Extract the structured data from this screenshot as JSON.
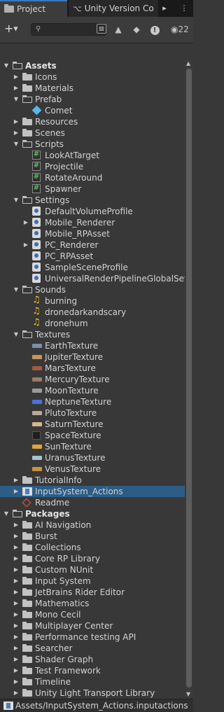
{
  "tabs": [
    {
      "label": "Project",
      "icon": "folder-icon",
      "active": true
    },
    {
      "label": "Unity Version Co",
      "icon": "version-control-icon",
      "active": false
    }
  ],
  "toolbar": {
    "create_label": "+",
    "search_placeholder": "",
    "hidden_count": "22"
  },
  "tree": [
    {
      "label": "Assets",
      "depth": 0,
      "arrow": "open",
      "icon": "folder-open",
      "bold": true
    },
    {
      "label": "Icons",
      "depth": 1,
      "arrow": "closed",
      "icon": "folder"
    },
    {
      "label": "Materials",
      "depth": 1,
      "arrow": "closed",
      "icon": "folder"
    },
    {
      "label": "Prefab",
      "depth": 1,
      "arrow": "open",
      "icon": "folder-open"
    },
    {
      "label": "Comet",
      "depth": 2,
      "arrow": "",
      "icon": "prefab"
    },
    {
      "label": "Resources",
      "depth": 1,
      "arrow": "closed",
      "icon": "folder"
    },
    {
      "label": "Scenes",
      "depth": 1,
      "arrow": "closed",
      "icon": "folder"
    },
    {
      "label": "Scripts",
      "depth": 1,
      "arrow": "open",
      "icon": "folder-open"
    },
    {
      "label": "LookAtTarget",
      "depth": 2,
      "arrow": "",
      "icon": "script"
    },
    {
      "label": "Projectile",
      "depth": 2,
      "arrow": "",
      "icon": "script"
    },
    {
      "label": "RotateAround",
      "depth": 2,
      "arrow": "",
      "icon": "script"
    },
    {
      "label": "Spawner",
      "depth": 2,
      "arrow": "",
      "icon": "script"
    },
    {
      "label": "Settings",
      "depth": 1,
      "arrow": "open",
      "icon": "folder-open"
    },
    {
      "label": "DefaultVolumeProfile",
      "depth": 2,
      "arrow": "",
      "icon": "asset"
    },
    {
      "label": "Mobile_Renderer",
      "depth": 2,
      "arrow": "closed",
      "icon": "asset"
    },
    {
      "label": "Mobile_RPAsset",
      "depth": 2,
      "arrow": "",
      "icon": "asset"
    },
    {
      "label": "PC_Renderer",
      "depth": 2,
      "arrow": "closed",
      "icon": "asset"
    },
    {
      "label": "PC_RPAsset",
      "depth": 2,
      "arrow": "",
      "icon": "asset"
    },
    {
      "label": "SampleSceneProfile",
      "depth": 2,
      "arrow": "",
      "icon": "asset"
    },
    {
      "label": "UniversalRenderPipelineGlobalSetti",
      "depth": 2,
      "arrow": "",
      "icon": "asset"
    },
    {
      "label": "Sounds",
      "depth": 1,
      "arrow": "open",
      "icon": "folder-open"
    },
    {
      "label": "burning",
      "depth": 2,
      "arrow": "",
      "icon": "audio"
    },
    {
      "label": "dronedarkandscary",
      "depth": 2,
      "arrow": "",
      "icon": "audio"
    },
    {
      "label": "dronehum",
      "depth": 2,
      "arrow": "",
      "icon": "audio"
    },
    {
      "label": "Textures",
      "depth": 1,
      "arrow": "open",
      "icon": "folder-open"
    },
    {
      "label": "EarthTexture",
      "depth": 2,
      "arrow": "",
      "icon": "texture",
      "color": "#7d8fa6"
    },
    {
      "label": "JupiterTexture",
      "depth": 2,
      "arrow": "",
      "icon": "texture",
      "color": "#c8935d"
    },
    {
      "label": "MarsTexture",
      "depth": 2,
      "arrow": "",
      "icon": "texture",
      "color": "#a45a3b"
    },
    {
      "label": "MercuryTexture",
      "depth": 2,
      "arrow": "",
      "icon": "texture",
      "color": "#9a7b63"
    },
    {
      "label": "MoonTexture",
      "depth": 2,
      "arrow": "",
      "icon": "texture",
      "color": "#9a9a9a"
    },
    {
      "label": "NeptuneTexture",
      "depth": 2,
      "arrow": "",
      "icon": "texture",
      "color": "#4f6fe0"
    },
    {
      "label": "PlutoTexture",
      "depth": 2,
      "arrow": "",
      "icon": "texture",
      "color": "#b8a89a"
    },
    {
      "label": "SaturnTexture",
      "depth": 2,
      "arrow": "",
      "icon": "texture",
      "color": "#d8b48a"
    },
    {
      "label": "SpaceTexture",
      "depth": 2,
      "arrow": "",
      "icon": "texture-dark",
      "color": "#1f1f1f"
    },
    {
      "label": "SunTexture",
      "depth": 2,
      "arrow": "",
      "icon": "texture",
      "color": "#e3a23a"
    },
    {
      "label": "UranusTexture",
      "depth": 2,
      "arrow": "",
      "icon": "texture",
      "color": "#a7c4cc"
    },
    {
      "label": "VenusTexture",
      "depth": 2,
      "arrow": "",
      "icon": "texture",
      "color": "#c8923f"
    },
    {
      "label": "TutorialInfo",
      "depth": 1,
      "arrow": "closed",
      "icon": "folder"
    },
    {
      "label": "InputSystem_Actions",
      "depth": 1,
      "arrow": "closed",
      "icon": "input-actions",
      "selected": true
    },
    {
      "label": "Readme",
      "depth": 1,
      "arrow": "",
      "icon": "readme"
    },
    {
      "label": "Packages",
      "depth": 0,
      "arrow": "open",
      "icon": "folder-open",
      "bold": true
    },
    {
      "label": "AI Navigation",
      "depth": 1,
      "arrow": "closed",
      "icon": "folder"
    },
    {
      "label": "Burst",
      "depth": 1,
      "arrow": "closed",
      "icon": "folder"
    },
    {
      "label": "Collections",
      "depth": 1,
      "arrow": "closed",
      "icon": "folder"
    },
    {
      "label": "Core RP Library",
      "depth": 1,
      "arrow": "closed",
      "icon": "folder"
    },
    {
      "label": "Custom NUnit",
      "depth": 1,
      "arrow": "closed",
      "icon": "folder"
    },
    {
      "label": "Input System",
      "depth": 1,
      "arrow": "closed",
      "icon": "folder"
    },
    {
      "label": "JetBrains Rider Editor",
      "depth": 1,
      "arrow": "closed",
      "icon": "folder"
    },
    {
      "label": "Mathematics",
      "depth": 1,
      "arrow": "closed",
      "icon": "folder"
    },
    {
      "label": "Mono Cecil",
      "depth": 1,
      "arrow": "closed",
      "icon": "folder"
    },
    {
      "label": "Multiplayer Center",
      "depth": 1,
      "arrow": "closed",
      "icon": "folder"
    },
    {
      "label": "Performance testing API",
      "depth": 1,
      "arrow": "closed",
      "icon": "folder"
    },
    {
      "label": "Searcher",
      "depth": 1,
      "arrow": "closed",
      "icon": "folder"
    },
    {
      "label": "Shader Graph",
      "depth": 1,
      "arrow": "closed",
      "icon": "folder"
    },
    {
      "label": "Test Framework",
      "depth": 1,
      "arrow": "closed",
      "icon": "folder"
    },
    {
      "label": "Timeline",
      "depth": 1,
      "arrow": "closed",
      "icon": "folder"
    },
    {
      "label": "Unity Light Transport Library",
      "depth": 1,
      "arrow": "closed",
      "icon": "folder"
    }
  ],
  "status": {
    "path": "Assets/InputSystem_Actions.inputactions",
    "icon": "input-actions-icon"
  }
}
